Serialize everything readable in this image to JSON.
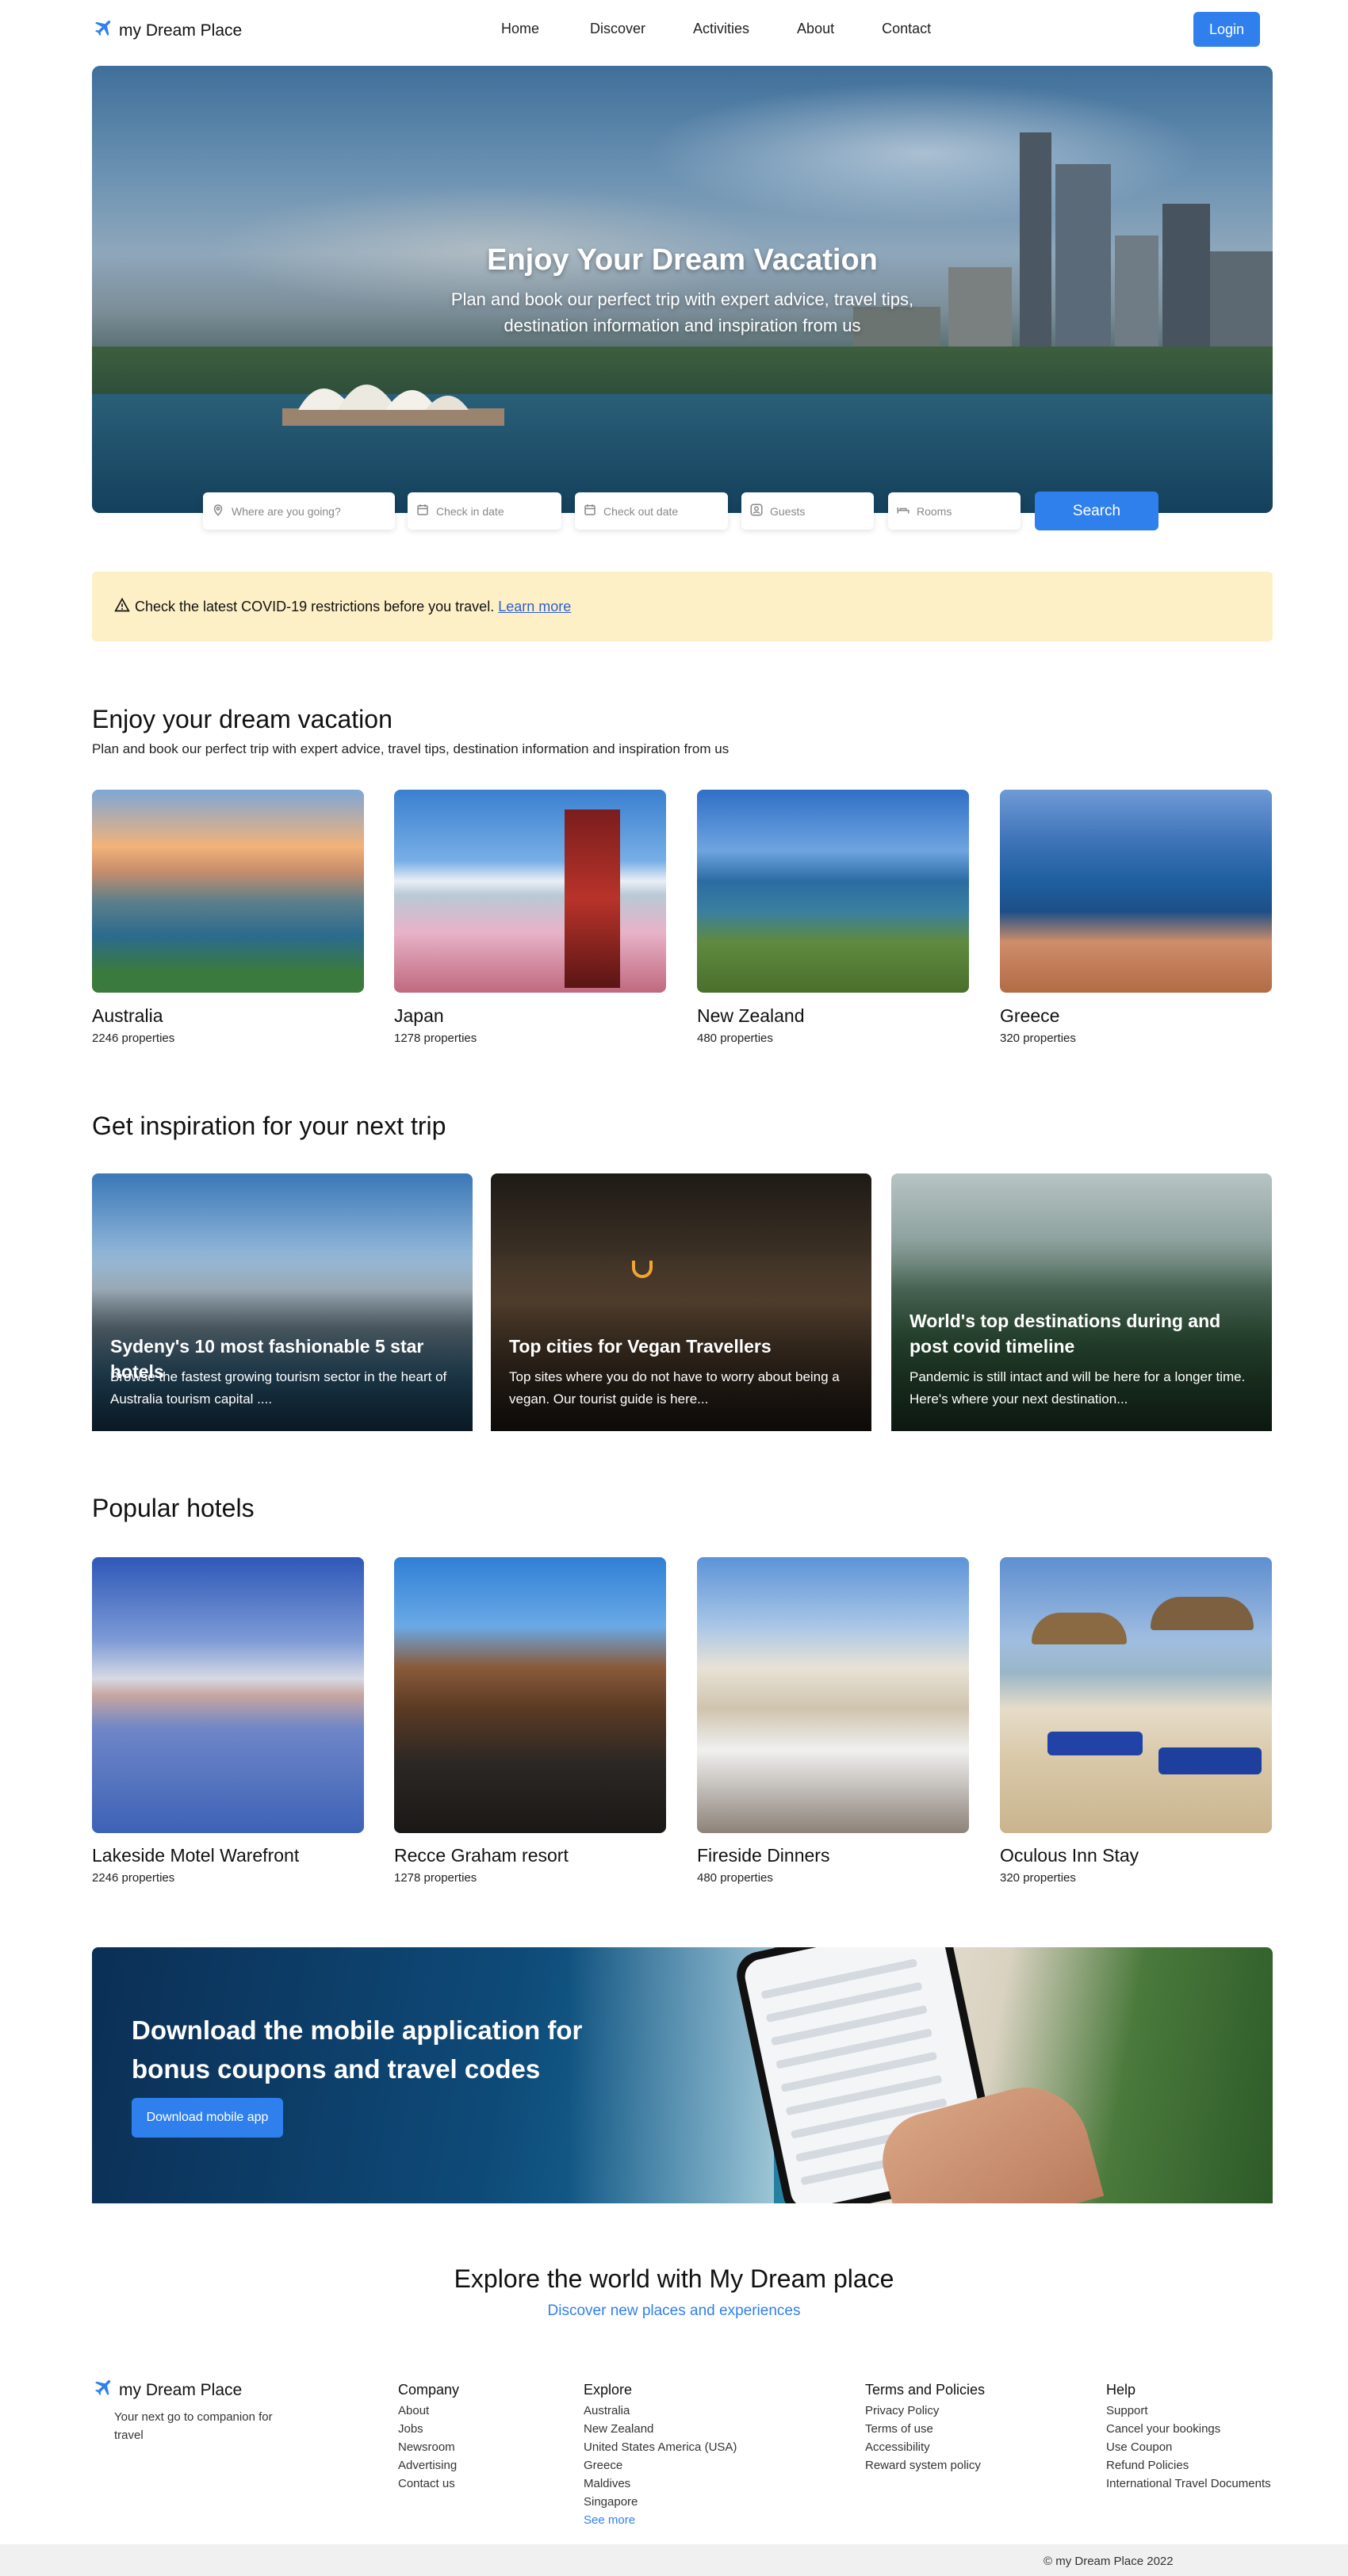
{
  "brand": {
    "name": "my Dream Place"
  },
  "nav": {
    "items": [
      "Home",
      "Discover",
      "Activities",
      "About",
      "Contact"
    ],
    "login": "Login"
  },
  "hero": {
    "title": "Enjoy Your Dream Vacation",
    "subtitle": "Plan and book our perfect trip with expert advice, travel tips, destination information and inspiration from us"
  },
  "search": {
    "destination_placeholder": "Where are you going?",
    "checkin_placeholder": "Check in date",
    "checkout_placeholder": "Check out date",
    "guests_placeholder": "Guests",
    "rooms_placeholder": "Rooms",
    "button": "Search"
  },
  "alert": {
    "text": "Check the latest COVID-19 restrictions before you travel.",
    "link": "Learn more"
  },
  "vacation": {
    "title": "Enjoy your dream vacation",
    "subtitle": "Plan and book our perfect trip with expert advice, travel tips, destination information and inspiration from us",
    "destinations": [
      {
        "name": "Australia",
        "meta": "2246 properties"
      },
      {
        "name": "Japan",
        "meta": "1278 properties"
      },
      {
        "name": "New Zealand",
        "meta": "480 properties"
      },
      {
        "name": "Greece",
        "meta": "320 properties"
      }
    ]
  },
  "inspiration": {
    "title": "Get inspiration for your next trip",
    "cards": [
      {
        "title": "Sydeny's 10 most fashionable 5 star hotels",
        "desc": "Browse the fastest growing tourism sector in the heart of Australia tourism capital ...."
      },
      {
        "title": "Top cities for Vegan Travellers",
        "desc": "Top sites where you do not have to worry about being a vegan. Our tourist guide is here..."
      },
      {
        "title": "World's top destinations during and post covid timeline",
        "desc": "Pandemic is still intact and will be here for a longer time. Here's where your next destination..."
      }
    ]
  },
  "hotels": {
    "title": "Popular hotels",
    "items": [
      {
        "name": "Lakeside Motel Warefront",
        "meta": "2246 properties"
      },
      {
        "name": "Recce Graham resort",
        "meta": "1278 properties"
      },
      {
        "name": "Fireside Dinners",
        "meta": "480 properties"
      },
      {
        "name": "Oculous Inn Stay",
        "meta": "320 properties"
      }
    ]
  },
  "app_banner": {
    "title": "Download the mobile application for bonus coupons and travel codes",
    "button": "Download mobile app"
  },
  "explore": {
    "title": "Explore the world with My Dream place",
    "subtitle": "Discover new places and experiences"
  },
  "footer": {
    "tagline": "Your next go to companion for travel",
    "company": {
      "title": "Company",
      "items": [
        "About",
        "Jobs",
        "Newsroom",
        "Advertising",
        "Contact us"
      ]
    },
    "explore": {
      "title": "Explore",
      "items": [
        "Australia",
        "New Zealand",
        "United States America (USA)",
        "Greece",
        "Maldives",
        "Singapore"
      ],
      "more": "See more"
    },
    "terms": {
      "title": "Terms and Policies",
      "items": [
        "Privacy Policy",
        "Terms of use",
        "Accessibility",
        "Reward system policy"
      ]
    },
    "help": {
      "title": "Help",
      "items": [
        "Support",
        "Cancel your bookings",
        "Use Coupon",
        "Refund Policies",
        "International Travel Documents"
      ]
    },
    "copyright": "© my Dream Place 2022"
  },
  "colors": {
    "accent": "#2f80ed",
    "alert_bg": "#fdefc6",
    "footer_bar": "#f0f0f0"
  },
  "icons": [
    "plane-icon",
    "location-icon",
    "calendar-icon",
    "person-icon",
    "bed-icon",
    "warning-icon"
  ]
}
